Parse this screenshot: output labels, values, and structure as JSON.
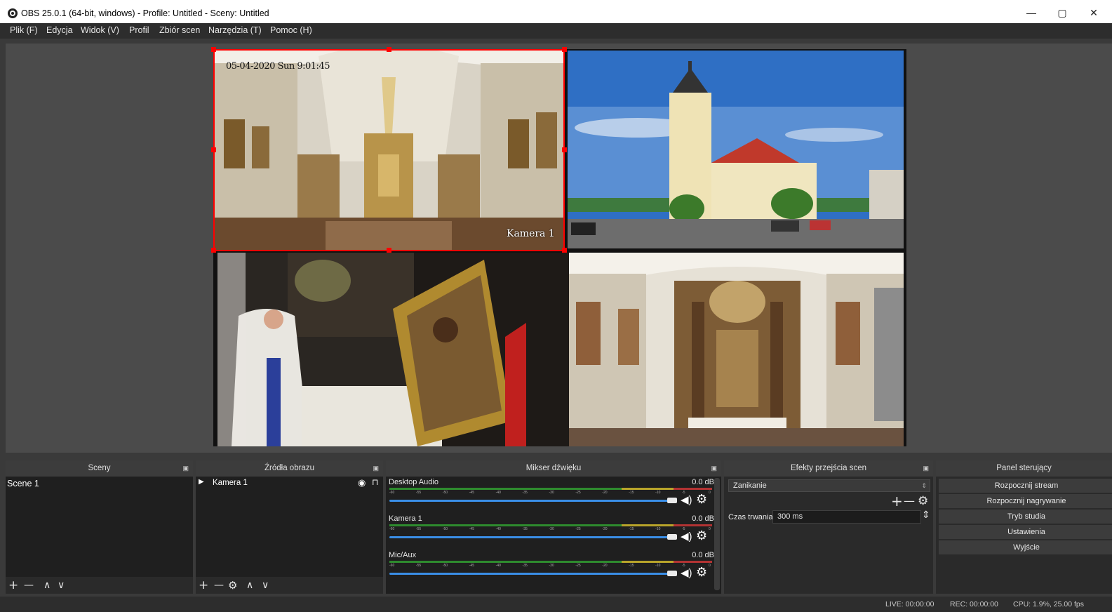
{
  "window": {
    "title": "OBS 25.0.1 (64-bit, windows) - Profile: Untitled - Sceny: Untitled",
    "minimize": "—",
    "maximize": "▢",
    "close": "✕"
  },
  "menu": {
    "items": [
      "Plik (F)",
      "Edycja",
      "Widok (V)",
      "Profil",
      "Zbiór scen",
      "Narzędzia (T)",
      "Pomoc (H)"
    ]
  },
  "preview": {
    "timestamp": "05-04-2020 Sun 9:01:45",
    "camera_label": "Kamera 1"
  },
  "scenes": {
    "title": "Sceny",
    "items": [
      "Scene 1"
    ],
    "toolbar": {
      "add": "+",
      "remove": "—",
      "up": "∧",
      "down": "∨"
    }
  },
  "sources": {
    "title": "Źródła obrazu",
    "items": [
      {
        "label": "Kamera 1"
      }
    ],
    "toolbar": {
      "add": "+",
      "remove": "—",
      "props": "⚙",
      "up": "∧",
      "down": "∨"
    }
  },
  "mixer": {
    "title": "Mikser dźwięku",
    "ticks": [
      "-60",
      "-55",
      "-50",
      "-45",
      "-40",
      "-35",
      "-30",
      "-25",
      "-20",
      "-15",
      "-10",
      "-5",
      "0"
    ],
    "channels": [
      {
        "name": "Desktop Audio",
        "db": "0.0 dB",
        "volume": 1.0
      },
      {
        "name": "Kamera 1",
        "db": "0.0 dB",
        "volume": 1.0
      },
      {
        "name": "Mic/Aux",
        "db": "0.0 dB",
        "volume": 1.0
      }
    ]
  },
  "transitions": {
    "title": "Efekty przejścia scen",
    "selected": "Zanikanie",
    "duration_label": "Czas trwania",
    "duration_value": "300 ms"
  },
  "controls": {
    "title": "Panel sterujący",
    "buttons": [
      "Rozpocznij stream",
      "Rozpocznij nagrywanie",
      "Tryb studia",
      "Ustawienia",
      "Wyjście"
    ]
  },
  "status": {
    "live": "LIVE: 00:00:00",
    "rec": "REC: 00:00:00",
    "cpu": "CPU: 1.9%, 25.00 fps"
  }
}
